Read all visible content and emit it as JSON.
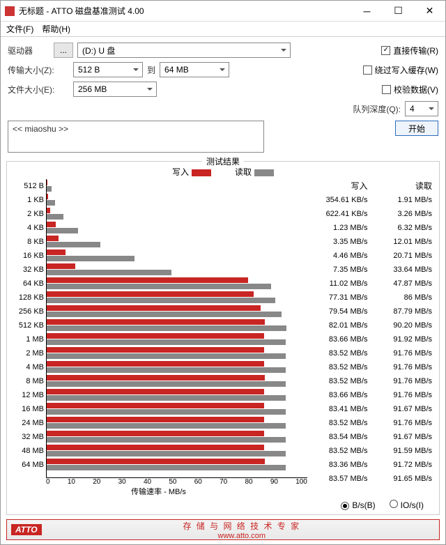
{
  "window": {
    "title": "无标题 - ATTO 磁盘基准测试 4.00"
  },
  "menu": {
    "file": "文件(F)",
    "help": "帮助(H)"
  },
  "labels": {
    "drive": "驱动器",
    "browse": "...",
    "transfer_size": "传输大小(Z):",
    "to": "到",
    "file_size": "文件大小(E):",
    "direct": "直接传输(R)",
    "bypass": "绕过写入缓存(W)",
    "verify": "校验数据(V)",
    "queue": "队列深度(Q):",
    "start": "开始",
    "results": "测试结果",
    "write": "写入",
    "read": "读取",
    "rate": "传输速率 - MB/s",
    "bps": "B/s(B)",
    "ios": "IO/s(I)"
  },
  "settings": {
    "drive": "(D:) U 盘",
    "size_from": "512 B",
    "size_to": "64 MB",
    "file_size": "256 MB",
    "queue": "4",
    "direct_checked": true,
    "bypass_checked": false,
    "verify_checked": false,
    "description": "<< miaoshu >>",
    "unit_bps": true
  },
  "footer": {
    "brand": "ATTO",
    "text": "存 储 与 网 络 技 术 专 家",
    "url": "www.atto.com"
  },
  "chart_data": {
    "type": "bar",
    "xlabel": "传输速率 - MB/s",
    "xlim": [
      0,
      100
    ],
    "xticks": [
      0,
      10,
      20,
      30,
      40,
      50,
      60,
      70,
      80,
      90,
      100
    ],
    "categories": [
      "512 B",
      "1 KB",
      "2 KB",
      "4 KB",
      "8 KB",
      "16 KB",
      "32 KB",
      "64 KB",
      "128 KB",
      "256 KB",
      "512 KB",
      "1 MB",
      "2 MB",
      "4 MB",
      "8 MB",
      "12 MB",
      "16 MB",
      "24 MB",
      "32 MB",
      "48 MB",
      "64 MB"
    ],
    "series": [
      {
        "name": "写入 (MB/s)",
        "color": "#c82523",
        "values": [
          0.346,
          0.608,
          1.23,
          3.35,
          4.46,
          7.35,
          11.02,
          77.31,
          79.54,
          82.01,
          83.66,
          83.52,
          83.52,
          83.52,
          83.66,
          83.41,
          83.52,
          83.54,
          83.52,
          83.36,
          83.57
        ]
      },
      {
        "name": "读取 (MB/s)",
        "color": "#888888",
        "values": [
          1.91,
          3.26,
          6.32,
          12.01,
          20.71,
          33.64,
          47.87,
          86,
          87.79,
          90.2,
          91.92,
          91.76,
          91.76,
          91.76,
          91.76,
          91.67,
          91.76,
          91.67,
          91.59,
          91.72,
          91.65
        ]
      }
    ],
    "write_display": [
      "354.61 KB/s",
      "622.41 KB/s",
      "1.23 MB/s",
      "3.35 MB/s",
      "4.46 MB/s",
      "7.35 MB/s",
      "11.02 MB/s",
      "77.31 MB/s",
      "79.54 MB/s",
      "82.01 MB/s",
      "83.66 MB/s",
      "83.52 MB/s",
      "83.52 MB/s",
      "83.52 MB/s",
      "83.66 MB/s",
      "83.41 MB/s",
      "83.52 MB/s",
      "83.54 MB/s",
      "83.52 MB/s",
      "83.36 MB/s",
      "83.57 MB/s"
    ],
    "read_display": [
      "1.91 MB/s",
      "3.26 MB/s",
      "6.32 MB/s",
      "12.01 MB/s",
      "20.71 MB/s",
      "33.64 MB/s",
      "47.87 MB/s",
      "86 MB/s",
      "87.79 MB/s",
      "90.20 MB/s",
      "91.92 MB/s",
      "91.76 MB/s",
      "91.76 MB/s",
      "91.76 MB/s",
      "91.76 MB/s",
      "91.67 MB/s",
      "91.76 MB/s",
      "91.67 MB/s",
      "91.59 MB/s",
      "91.72 MB/s",
      "91.65 MB/s"
    ]
  }
}
